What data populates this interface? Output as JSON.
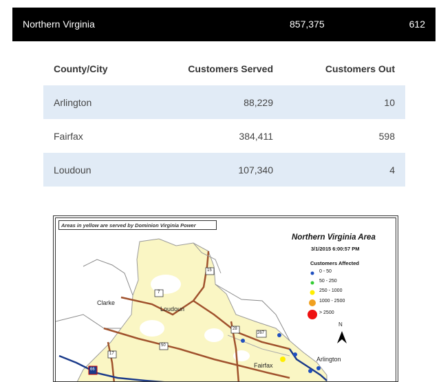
{
  "region": {
    "name": "Northern Virginia",
    "served": "857,375",
    "out": "612"
  },
  "table": {
    "headers": [
      "County/City",
      "Customers Served",
      "Customers Out"
    ],
    "rows": [
      {
        "name": "Arlington",
        "served": "88,229",
        "out": "10"
      },
      {
        "name": "Fairfax",
        "served": "384,411",
        "out": "598"
      },
      {
        "name": "Loudoun",
        "served": "107,340",
        "out": "4"
      }
    ]
  },
  "map": {
    "note": "Areas in yellow are served by Dominion Virginia Power",
    "title": "Northern Virginia Area",
    "date": "3/1/2015 6:00:57 PM",
    "legend_title": "Customers Affected",
    "legend": [
      {
        "label": "0 - 50",
        "color": "#1f4fbf"
      },
      {
        "label": "50 - 250",
        "color": "#33cc33"
      },
      {
        "label": "250 - 1000",
        "color": "#ffee00"
      },
      {
        "label": "1000 - 2500",
        "color": "#f0a020"
      },
      {
        "label": "> 2500",
        "color": "#ee1111"
      }
    ],
    "labels": {
      "clarke": "Clarke",
      "loudoun": "Loudoun",
      "fairfax": "Fairfax",
      "arlington": "Arlington",
      "north": "N"
    },
    "routes": {
      "r15": "15",
      "r7": "7",
      "r28": "28",
      "r267": "267",
      "r17": "17",
      "r50": "50",
      "r66": "66"
    },
    "fill_color": "#faf6c4"
  }
}
